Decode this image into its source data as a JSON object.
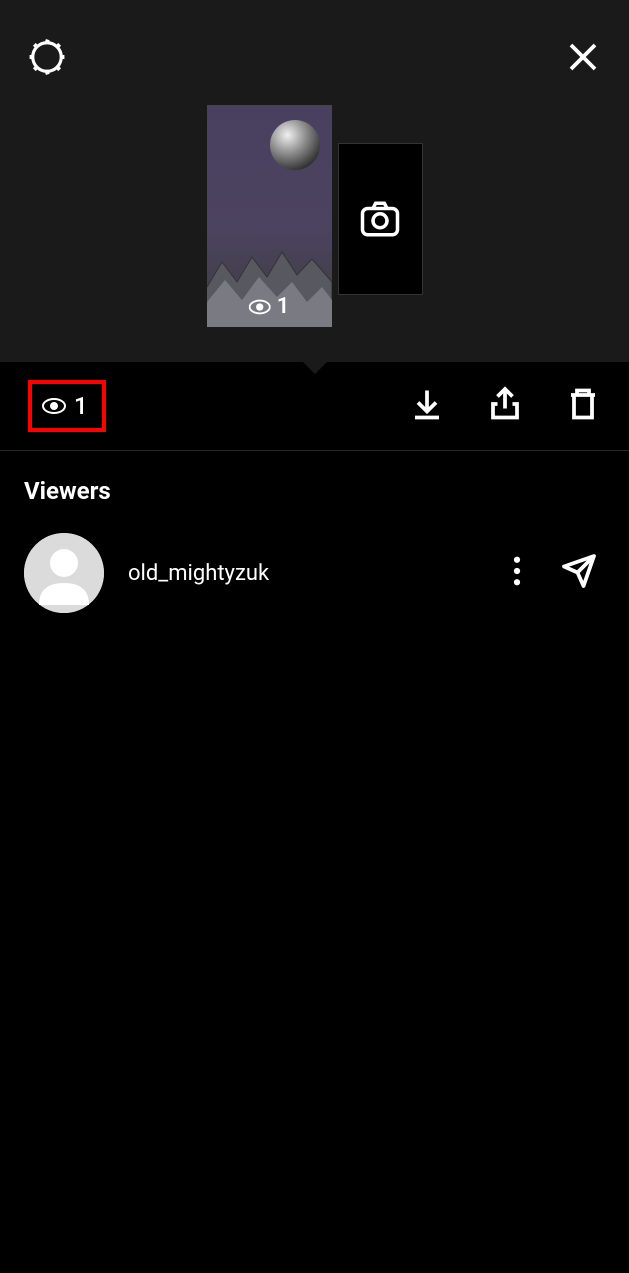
{
  "header": {
    "settings_icon": "settings",
    "close_icon": "close"
  },
  "story": {
    "view_count": "1",
    "add_icon": "camera"
  },
  "action_bar": {
    "view_count": "1",
    "download_icon": "download",
    "share_icon": "share",
    "delete_icon": "trash"
  },
  "viewers": {
    "title": "Viewers",
    "list": [
      {
        "username": "old_mightyzuk",
        "more_icon": "more",
        "send_icon": "send"
      }
    ]
  }
}
